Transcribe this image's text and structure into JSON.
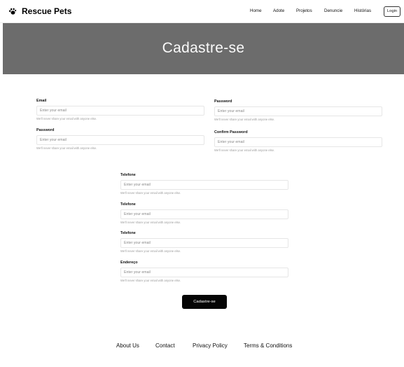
{
  "brand": {
    "name": "Rescue Pets",
    "icon": "paw-icon"
  },
  "nav": {
    "items": [
      "Home",
      "Adote",
      "Projetos",
      "Denuncie",
      "Histórias"
    ],
    "login_label": "Login"
  },
  "hero": {
    "title": "Cadastre-se"
  },
  "form": {
    "left": [
      {
        "label": "Email",
        "placeholder": "Enter your email",
        "help": "We'll never share your email with anyone else."
      },
      {
        "label": "Password",
        "placeholder": "Enter your email",
        "help": "We'll never share your email with anyone else."
      }
    ],
    "right": [
      {
        "label": "Password",
        "placeholder": "Enter your email",
        "help": "We'll never share your email with anyone else."
      },
      {
        "label": "Confirm Password",
        "placeholder": "Enter your email",
        "help": "We'll never share your email with anyone else."
      }
    ],
    "center": [
      {
        "label": "Telefone",
        "placeholder": "Enter your email",
        "help": "We'll never share your email with anyone else."
      },
      {
        "label": "Telefone",
        "placeholder": "Enter your email",
        "help": "We'll never share your email with anyone else."
      },
      {
        "label": "Telefone",
        "placeholder": "Enter your email",
        "help": "We'll never share your email with anyone else."
      },
      {
        "label": "Endereço",
        "placeholder": "Enter your email",
        "help": "We'll never share your email with anyone else."
      }
    ],
    "submit_label": "Cadastre-se"
  },
  "footer": {
    "links": [
      "About Us",
      "Contact",
      "Privacy Policy",
      "Terms & Conditions"
    ]
  },
  "colors": {
    "hero_bg": "#6c6c6c",
    "button_bg": "#050505"
  }
}
